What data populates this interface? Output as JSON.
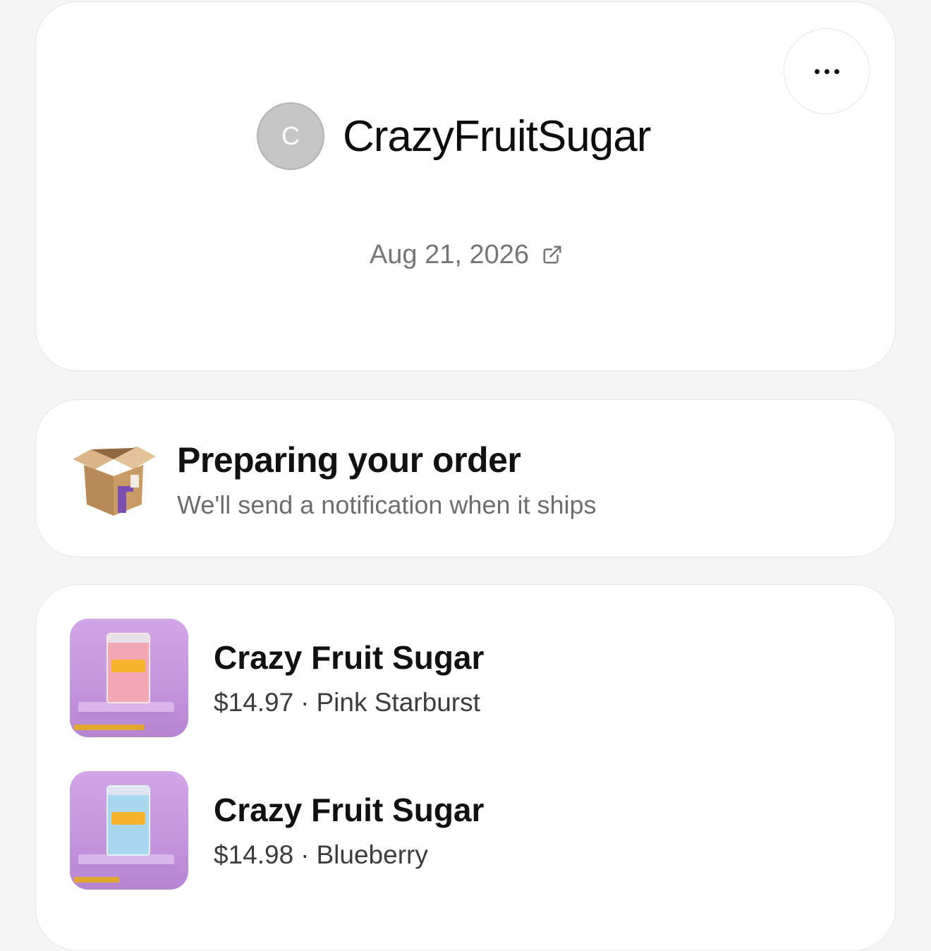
{
  "header": {
    "avatar_initial": "C",
    "store_name": "CrazyFruitSugar",
    "order_date": "Aug 21, 2026",
    "more_icon": "ellipsis-icon",
    "date_link_icon": "external-link-icon"
  },
  "status": {
    "icon": "open-box-icon",
    "title": "Preparing your order",
    "subtitle": "We'll send a notification when it ships"
  },
  "items": [
    {
      "name": "Crazy Fruit Sugar",
      "price": "$14.97",
      "separator": "·",
      "variant": "Pink Starburst",
      "bag_color": "#f2a8b4"
    },
    {
      "name": "Crazy Fruit Sugar",
      "price": "$14.98",
      "separator": "·",
      "variant": "Blueberry",
      "bag_color": "#a9d8ee"
    }
  ],
  "colors": {
    "background": "#f5f5f5",
    "card": "#ffffff",
    "avatar": "#c6c6c6",
    "thumb_purple": "#c395dc"
  }
}
